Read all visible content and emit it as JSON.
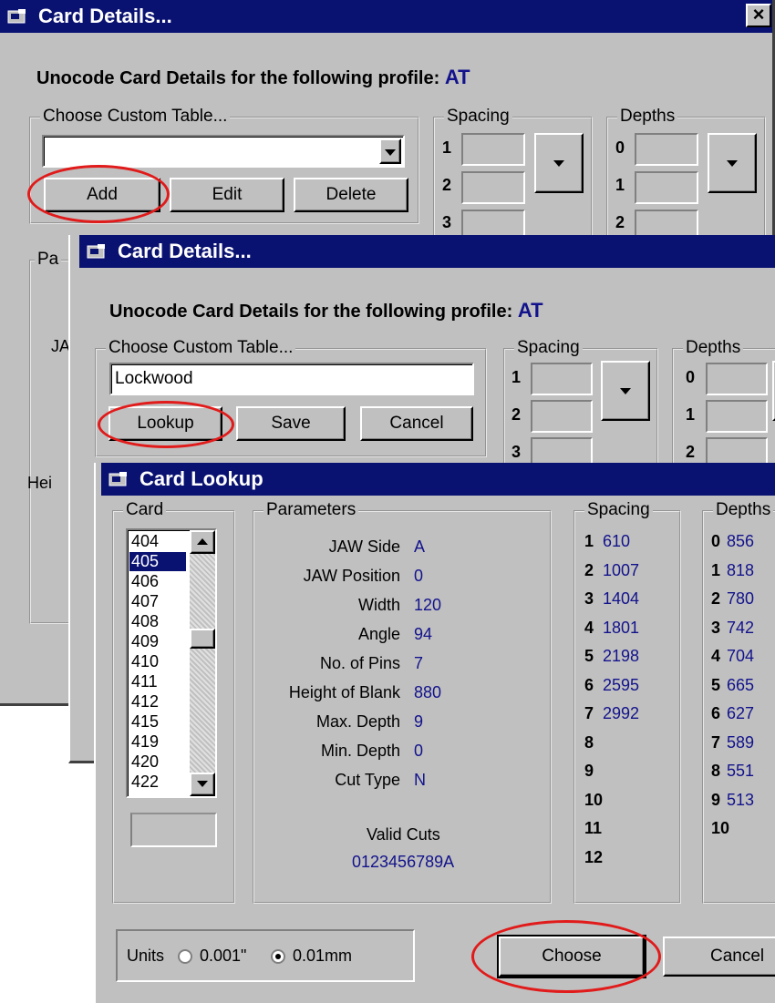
{
  "window1": {
    "title": "Card Details...",
    "close_glyph": "×",
    "heading": "Unocode Card Details for the following profile:",
    "profile": "AT",
    "custom_table_group": "Choose Custom Table...",
    "combo_value": "",
    "buttons": {
      "add": "Add",
      "edit": "Edit",
      "delete": "Delete"
    },
    "spacing_group": "Spacing",
    "spacing_rows": [
      "1",
      "2",
      "3"
    ],
    "depths_group": "Depths",
    "depths_rows": [
      "0",
      "1",
      "2"
    ],
    "partial_param_group": "Pa",
    "partial_ja": "JA",
    "partial_hei": "Hei"
  },
  "window2": {
    "title": "Card Details...",
    "heading": "Unocode Card Details for the following profile:",
    "profile": "AT",
    "custom_table_group": "Choose Custom Table...",
    "input_value": "Lockwood",
    "buttons": {
      "lookup": "Lookup",
      "save": "Save",
      "cancel": "Cancel"
    },
    "spacing_group": "Spacing",
    "spacing_rows": [
      "1",
      "2",
      "3"
    ],
    "depths_group": "Depths",
    "depths_rows": [
      "0",
      "1",
      "2"
    ]
  },
  "window3": {
    "title": "Card Lookup",
    "card_group": "Card",
    "cards": [
      "404",
      "405",
      "406",
      "407",
      "408",
      "409",
      "410",
      "411",
      "412",
      "415",
      "419",
      "420",
      "422"
    ],
    "selected_card": "405",
    "parameters_group": "Parameters",
    "parameters": [
      {
        "label": "JAW Side",
        "value": "A"
      },
      {
        "label": "JAW Position",
        "value": "0"
      },
      {
        "label": "Width",
        "value": "120"
      },
      {
        "label": "Angle",
        "value": "94"
      },
      {
        "label": "No. of Pins",
        "value": "7"
      },
      {
        "label": "Height of Blank",
        "value": "880"
      },
      {
        "label": "Max. Depth",
        "value": "9"
      },
      {
        "label": "Min. Depth",
        "value": "0"
      },
      {
        "label": "Cut Type",
        "value": "N"
      }
    ],
    "valid_cuts_label": "Valid Cuts",
    "valid_cuts_value": "0123456789A",
    "spacing_group": "Spacing",
    "spacing": [
      {
        "idx": "1",
        "value": "610"
      },
      {
        "idx": "2",
        "value": "1007"
      },
      {
        "idx": "3",
        "value": "1404"
      },
      {
        "idx": "4",
        "value": "1801"
      },
      {
        "idx": "5",
        "value": "2198"
      },
      {
        "idx": "6",
        "value": "2595"
      },
      {
        "idx": "7",
        "value": "2992"
      },
      {
        "idx": "8",
        "value": ""
      },
      {
        "idx": "9",
        "value": ""
      },
      {
        "idx": "10",
        "value": ""
      },
      {
        "idx": "11",
        "value": ""
      },
      {
        "idx": "12",
        "value": ""
      }
    ],
    "depths_group": "Depths",
    "depths": [
      {
        "idx": "0",
        "value": "856"
      },
      {
        "idx": "1",
        "value": "818"
      },
      {
        "idx": "2",
        "value": "780"
      },
      {
        "idx": "3",
        "value": "742"
      },
      {
        "idx": "4",
        "value": "704"
      },
      {
        "idx": "5",
        "value": "665"
      },
      {
        "idx": "6",
        "value": "627"
      },
      {
        "idx": "7",
        "value": "589"
      },
      {
        "idx": "8",
        "value": "551"
      },
      {
        "idx": "9",
        "value": "513"
      },
      {
        "idx": "10",
        "value": ""
      }
    ],
    "units_label": "Units",
    "unit_options": [
      {
        "label": "0.001\"",
        "selected": false
      },
      {
        "label": "0.01mm",
        "selected": true
      }
    ],
    "buttons": {
      "choose": "Choose",
      "cancel": "Cancel"
    }
  },
  "colors": {
    "titlebar": "#0a1271",
    "face": "#c0c0c0",
    "value_text": "#12128c",
    "highlight_ellipse": "#e11a1a"
  }
}
